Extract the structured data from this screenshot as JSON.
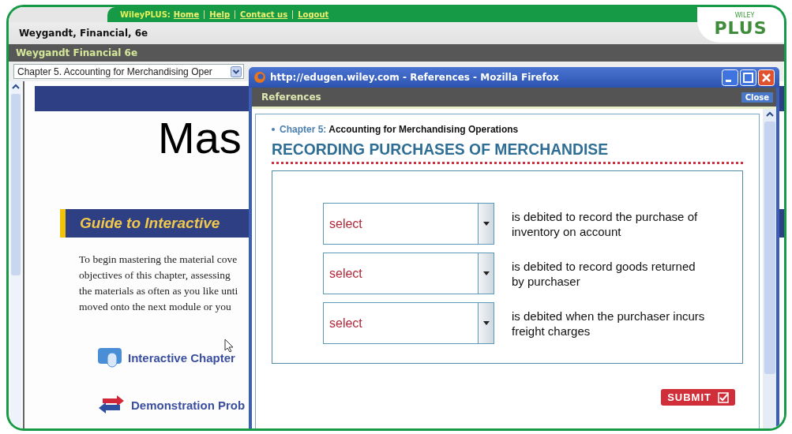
{
  "portal": {
    "label": "WileyPLUS:",
    "links": [
      "Home",
      "Help",
      "Contact us",
      "Logout"
    ],
    "course": "Weygandt, Financial, 6e",
    "logo": {
      "top": "WILEY",
      "main": "PLUS"
    }
  },
  "course_bar": "Weygandt Financial 6e",
  "chapter_select": {
    "value": "Chapter 5. Accounting for Merchandising Oper"
  },
  "page": {
    "title": "Mas",
    "guide": "Guide to Interactive",
    "paragraph": [
      "To begin mastering the material cove",
      "objectives of this chapter, assessing",
      "the materials as often as you like unti",
      "moved onto the next module or you"
    ],
    "links": [
      {
        "kind": "mouse",
        "label": "Interactive Chapter"
      },
      {
        "kind": "arrows",
        "label": "Demonstration Prob"
      }
    ]
  },
  "popup": {
    "title": "http://edugen.wiley.com - References - Mozilla Firefox",
    "bar_title": "References",
    "close": "Close",
    "chapter_label": "Chapter 5:",
    "chapter_title": "Accounting for Merchandising Operations",
    "heading": "RECORDING PURCHASES OF MERCHANDISE",
    "questions": [
      {
        "value": "select",
        "text": "is debited to record the purchase of inventory on account"
      },
      {
        "value": "select",
        "text": "is debited to record goods returned by purchaser"
      },
      {
        "value": "select",
        "text": "is debited when the purchaser incurs freight charges"
      }
    ],
    "submit": "SUBMIT"
  }
}
